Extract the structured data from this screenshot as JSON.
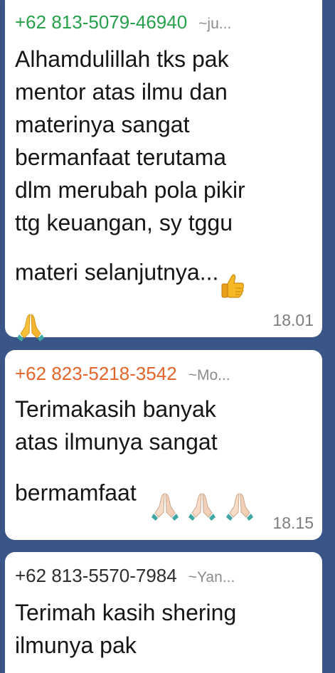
{
  "messages": [
    {
      "sender_phone": "+62 813-5079-46940",
      "sender_alias": "~ju...",
      "sender_color": "#26a04a",
      "text": "Alhamdulillah tks pak\nmentor atas ilmu dan\nmaterinya sangat\nbermanfaat terutama\ndlm merubah pola pikir\nttg keuangan, sy tggu\nmateri selanjutnya...",
      "emojis": [
        "thumbs-up-icon",
        "folded-hands-icon"
      ],
      "time": "18.01"
    },
    {
      "sender_phone": "+62 823-5218-3542",
      "sender_alias": "~Mo...",
      "sender_color": "#e3652a",
      "text": "Terimakasih banyak\natas ilmunya sangat\nbermamfaat",
      "emojis": [
        "folded-hands-icon",
        "folded-hands-icon",
        "folded-hands-icon"
      ],
      "time": "18.15"
    },
    {
      "sender_phone": "+62 813-5570-7984",
      "sender_alias": "~Yan...",
      "sender_color": "#2d2d2d",
      "text": "Terimah kasih shering\nilmunya pak",
      "emojis": [],
      "time": ""
    }
  ]
}
